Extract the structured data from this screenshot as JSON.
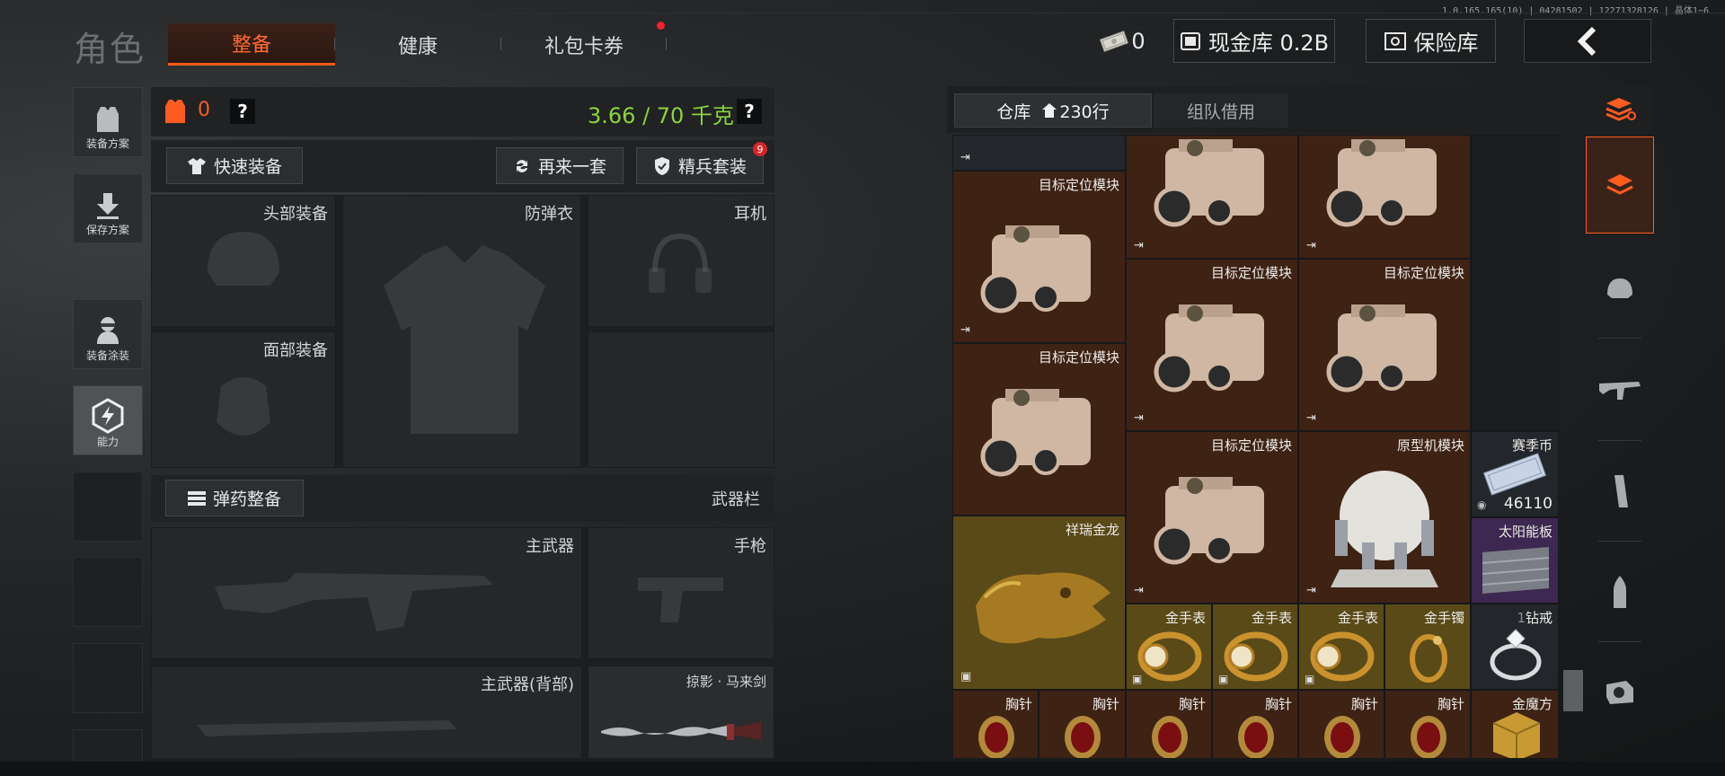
{
  "version": "1.0.165.165(10) | 04281502 | 12271328126 | 晶体1~6",
  "header": {
    "title": "角色",
    "tabs": [
      {
        "label": "整备",
        "active": true
      },
      {
        "label": "健康",
        "active": false
      },
      {
        "label": "礼包卡券",
        "active": false,
        "badge": true
      }
    ],
    "cash_count": "0",
    "cash_vault_label": "现金库 0.2B",
    "safe_label": "保险库"
  },
  "left_nav": {
    "items": [
      {
        "label": "装备方案"
      },
      {
        "label": "保存方案"
      },
      {
        "label": "装备涂装"
      },
      {
        "label": "能力"
      }
    ]
  },
  "equip": {
    "armor_level": "0",
    "weight": "3.66 / 70 千克",
    "quick_equip": "快速装备",
    "again": "再来一套",
    "elite": "精兵套装",
    "elite_badge": "9",
    "slots": {
      "head": "头部装备",
      "vest": "防弹衣",
      "headset": "耳机",
      "face": "面部装备"
    },
    "ammo": "弹药整备",
    "weapon_bar": "武器栏",
    "weapons": {
      "primary": "主武器",
      "pistol": "手枪",
      "primary_back": "主武器(背部)",
      "melee": "掠影 · 马来剑"
    }
  },
  "storage": {
    "tab_warehouse": "仓库",
    "rows": "230行",
    "tab_team": "组队借用",
    "items": {
      "target": "目标定位模块",
      "proto": "原型机模块",
      "coin": "赛季币",
      "coin_count": "46110",
      "solar": "太阳能板",
      "dragon": "祥瑞金龙",
      "watch": "金手表",
      "bracelet": "金手镯",
      "ring": "钻戒",
      "ring_prefix": "1",
      "brooch": "胸针",
      "cube": "金魔方"
    }
  },
  "colors": {
    "accent": "#ff5b1f",
    "weight_green": "#8bd43a",
    "brown_cell": "#3e2214",
    "gold_cell": "#5a4a18",
    "purple_cell": "#3c2850"
  }
}
